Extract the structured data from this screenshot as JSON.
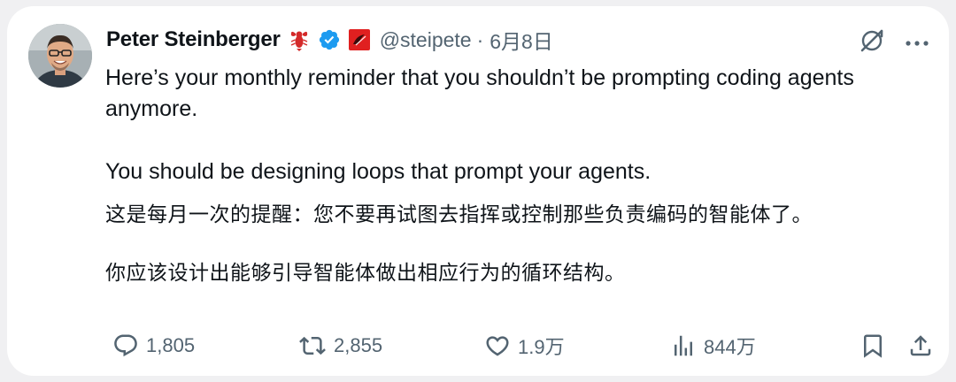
{
  "author": {
    "name": "Peter Steinberger",
    "handle": "@steipete",
    "separator": "·",
    "date": "6月8日",
    "verified_color": "#1d9bf0"
  },
  "tweet": {
    "line1": "Here’s your monthly reminder that you shouldn’t be prompting coding agents anymore.",
    "line2": "You should be designing loops that prompt your agents.",
    "zh1": "这是每月一次的提醒：您不要再试图去指挥或控制那些负责编码的智能体了。",
    "zh2": "你应该设计出能够引导智能体做出相应行为的循环结构。"
  },
  "actions": {
    "replies": "1,805",
    "reposts": "2,855",
    "likes": "1.9万",
    "views": "844万"
  },
  "icons": [
    "lobster-emoji-icon",
    "verified-badge-icon",
    "affiliate-badge-icon",
    "grok-icon",
    "more-icon",
    "reply-icon",
    "repost-icon",
    "like-icon",
    "views-icon",
    "bookmark-icon",
    "share-icon"
  ],
  "colors": {
    "text": "#0f1419",
    "muted": "#536471",
    "accent": "#1d9bf0",
    "background": "#ffffff"
  }
}
